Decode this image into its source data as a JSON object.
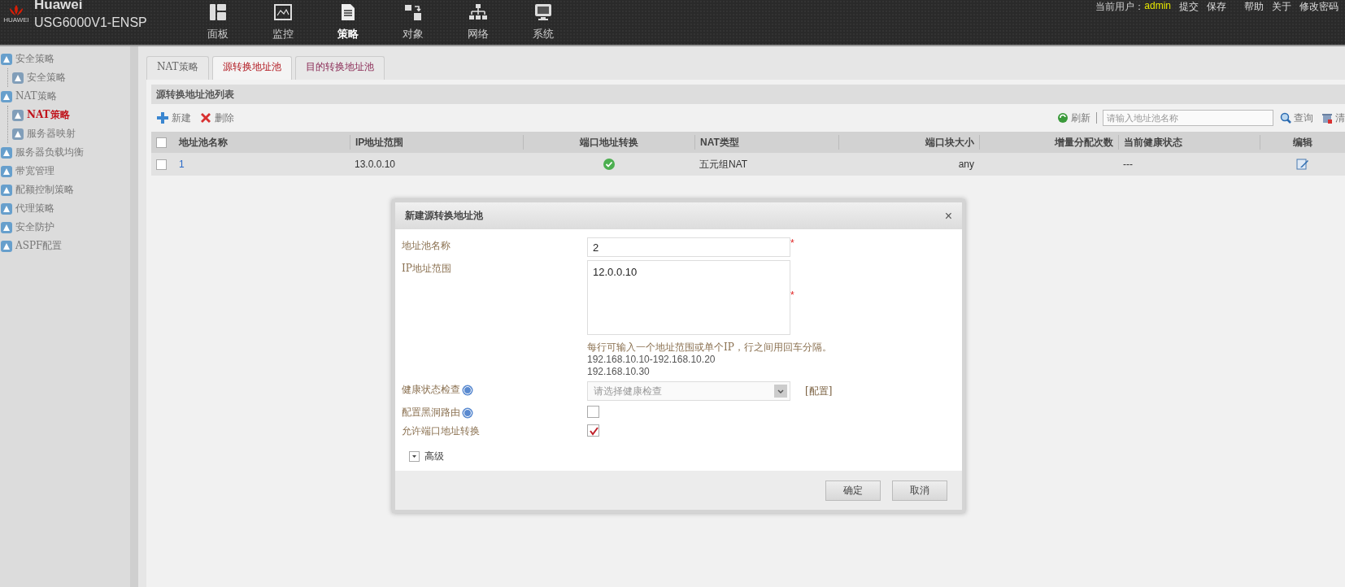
{
  "header": {
    "brand": "Huawei",
    "model": "USG6000V1-ENSP",
    "logo_text": "HUAWEI",
    "nav": [
      {
        "label": "面板",
        "selected": false
      },
      {
        "label": "监控",
        "selected": false
      },
      {
        "label": "策略",
        "selected": true
      },
      {
        "label": "对象",
        "selected": false
      },
      {
        "label": "网络",
        "selected": false
      },
      {
        "label": "系统",
        "selected": false
      }
    ],
    "user_label": "当前用户：",
    "user": "admin",
    "links": [
      "提交",
      "保存",
      "帮助",
      "关于",
      "修改密码"
    ]
  },
  "sidebar": {
    "items": [
      {
        "label": "安全策略",
        "selected": false,
        "expanded": true,
        "children": [
          {
            "label": "安全策略",
            "selected": false
          }
        ]
      },
      {
        "label": "NAT策略",
        "selected": false,
        "expanded": true,
        "children": [
          {
            "label": "NAT策略",
            "selected": true
          },
          {
            "label": "服务器映射",
            "selected": false
          }
        ]
      },
      {
        "label": "服务器负载均衡",
        "selected": false
      },
      {
        "label": "带宽管理",
        "selected": false
      },
      {
        "label": "配额控制策略",
        "selected": false
      },
      {
        "label": "代理策略",
        "selected": false
      },
      {
        "label": "安全防护",
        "selected": false
      },
      {
        "label": "ASPF配置",
        "selected": false
      }
    ]
  },
  "tabs": [
    {
      "label": "NAT策略",
      "selected": false
    },
    {
      "label": "源转换地址池",
      "selected": true
    },
    {
      "label": "目的转换地址池",
      "selected": false
    }
  ],
  "panel": {
    "title": "源转换地址池列表",
    "toolbar": {
      "new": "新建",
      "delete": "删除",
      "refresh": "刷新",
      "search": {
        "placeholder": "请输入地址池名称"
      },
      "query": "查询",
      "clear": "清"
    },
    "table": {
      "all_checked": false,
      "columns": [
        "地址池名称",
        "IP地址范围",
        "端口地址转换",
        "NAT类型",
        "端口块大小",
        "增量分配次数",
        "当前健康状态",
        "编辑"
      ],
      "rows": [
        {
          "checked": false,
          "name": "1",
          "ip_range": "13.0.0.10",
          "port_translation": true,
          "nat_type": "五元组NAT",
          "port_block": "any",
          "health": "---"
        }
      ]
    }
  },
  "dialog": {
    "title": "新建源转换地址池",
    "close": "×",
    "fields": [
      {
        "kind": "text",
        "label": "地址池名称",
        "value": "2",
        "required_mark": "*"
      },
      {
        "kind": "textarea",
        "label": "IP地址范围",
        "value": "12.0.0.10",
        "required_mark": "*",
        "hint": [
          "每行可输入一个地址范围或单个IP，行之间用回车分隔。",
          "192.168.10.10-192.168.10.20",
          "192.168.10.30"
        ]
      },
      {
        "kind": "select",
        "label": "健康状态检查",
        "help": true,
        "placeholder": "请选择健康检查",
        "link": "[配置]"
      },
      {
        "kind": "checkbox",
        "label": "配置黑洞路由",
        "help": true,
        "checked": false
      },
      {
        "kind": "checkbox",
        "label": "允许端口地址转换",
        "help": false,
        "checked": true
      }
    ],
    "advanced": {
      "label": "高级",
      "expanded": false
    },
    "buttons": [
      "确定",
      "取消"
    ]
  }
}
